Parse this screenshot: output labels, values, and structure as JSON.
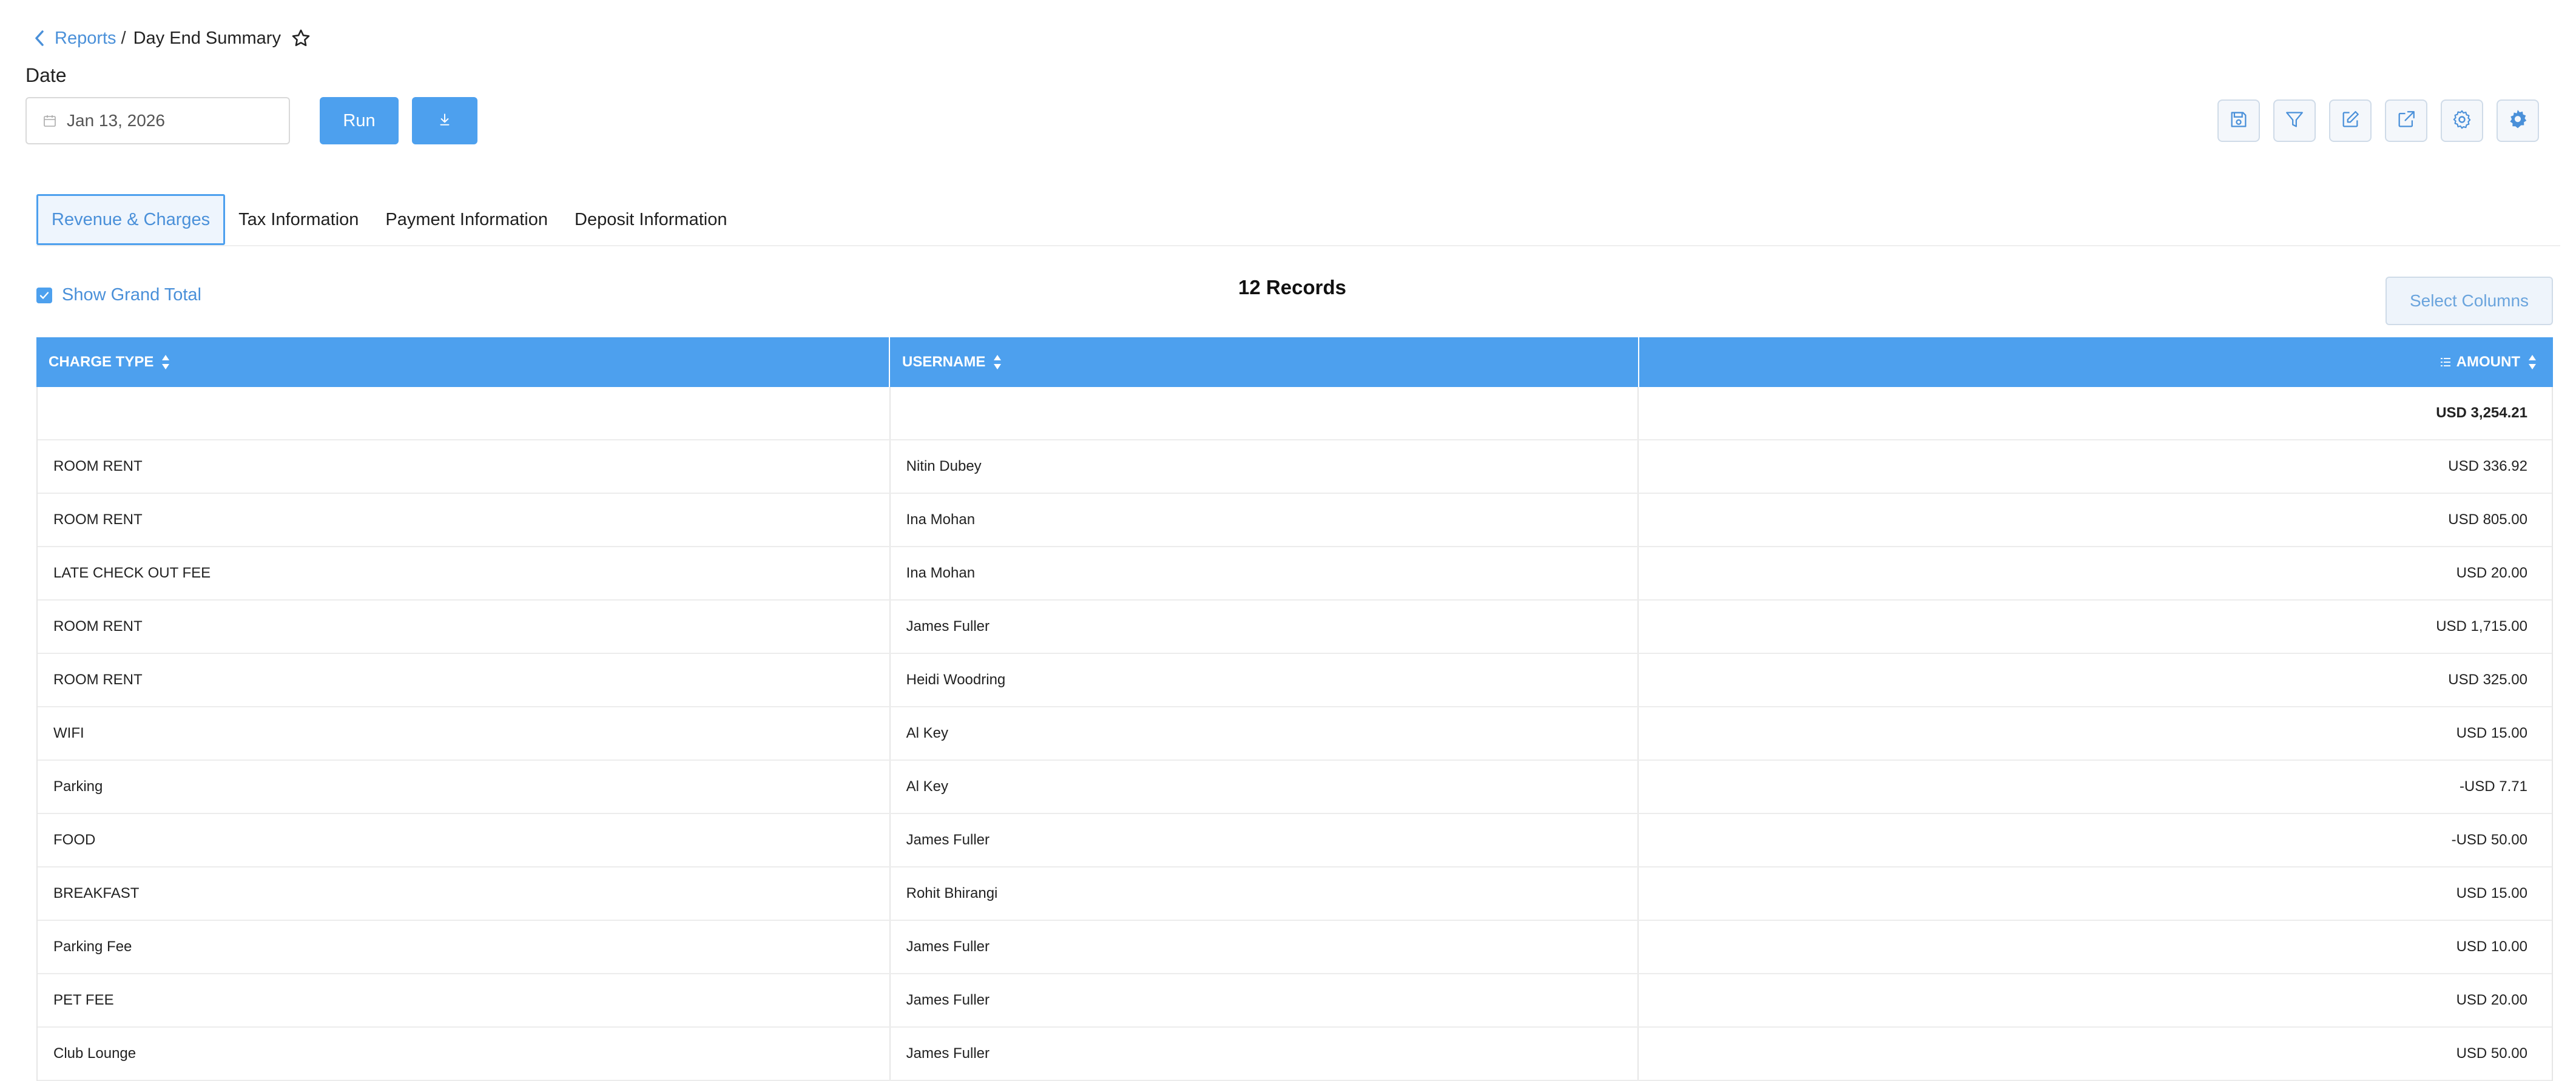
{
  "breadcrumb": {
    "parent": "Reports",
    "separator": "/",
    "current": "Day End Summary"
  },
  "date": {
    "label": "Date",
    "value": "Jan 13, 2026"
  },
  "actions": {
    "run": "Run"
  },
  "toolbar": [
    "save-icon",
    "filter-icon",
    "edit-icon",
    "external-link-icon",
    "settings-icon",
    "cog-settings-icon"
  ],
  "tabs": [
    {
      "label": "Revenue & Charges",
      "active": true
    },
    {
      "label": "Tax Information",
      "active": false
    },
    {
      "label": "Payment Information",
      "active": false
    },
    {
      "label": "Deposit Information",
      "active": false
    }
  ],
  "grand_total_toggle": {
    "label": "Show Grand Total",
    "checked": true
  },
  "records": "12 Records",
  "select_columns": "Select Columns",
  "table": {
    "columns": [
      "CHARGE TYPE",
      "USERNAME",
      "AMOUNT"
    ],
    "total": "USD 3,254.21",
    "rows": [
      {
        "charge": "ROOM RENT",
        "user": "Nitin Dubey",
        "amount": "USD 336.92"
      },
      {
        "charge": "ROOM RENT",
        "user": "Ina Mohan",
        "amount": "USD 805.00"
      },
      {
        "charge": "LATE CHECK OUT FEE",
        "user": "Ina Mohan",
        "amount": "USD 20.00"
      },
      {
        "charge": "ROOM RENT",
        "user": "James Fuller",
        "amount": "USD 1,715.00"
      },
      {
        "charge": "ROOM RENT",
        "user": "Heidi Woodring",
        "amount": "USD 325.00"
      },
      {
        "charge": "WIFI",
        "user": "Al Key",
        "amount": "USD 15.00"
      },
      {
        "charge": "Parking",
        "user": "Al Key",
        "amount": "-USD 7.71"
      },
      {
        "charge": "FOOD",
        "user": "James Fuller",
        "amount": "-USD 50.00"
      },
      {
        "charge": "BREAKFAST",
        "user": "Rohit Bhirangi",
        "amount": "USD 15.00"
      },
      {
        "charge": "Parking Fee",
        "user": "James Fuller",
        "amount": "USD 10.00"
      },
      {
        "charge": "PET FEE",
        "user": "James Fuller",
        "amount": "USD 20.00"
      },
      {
        "charge": "Club Lounge",
        "user": "James Fuller",
        "amount": "USD 50.00"
      }
    ]
  },
  "colors": {
    "accent": "#4da0ee",
    "link": "#4a90d9"
  }
}
